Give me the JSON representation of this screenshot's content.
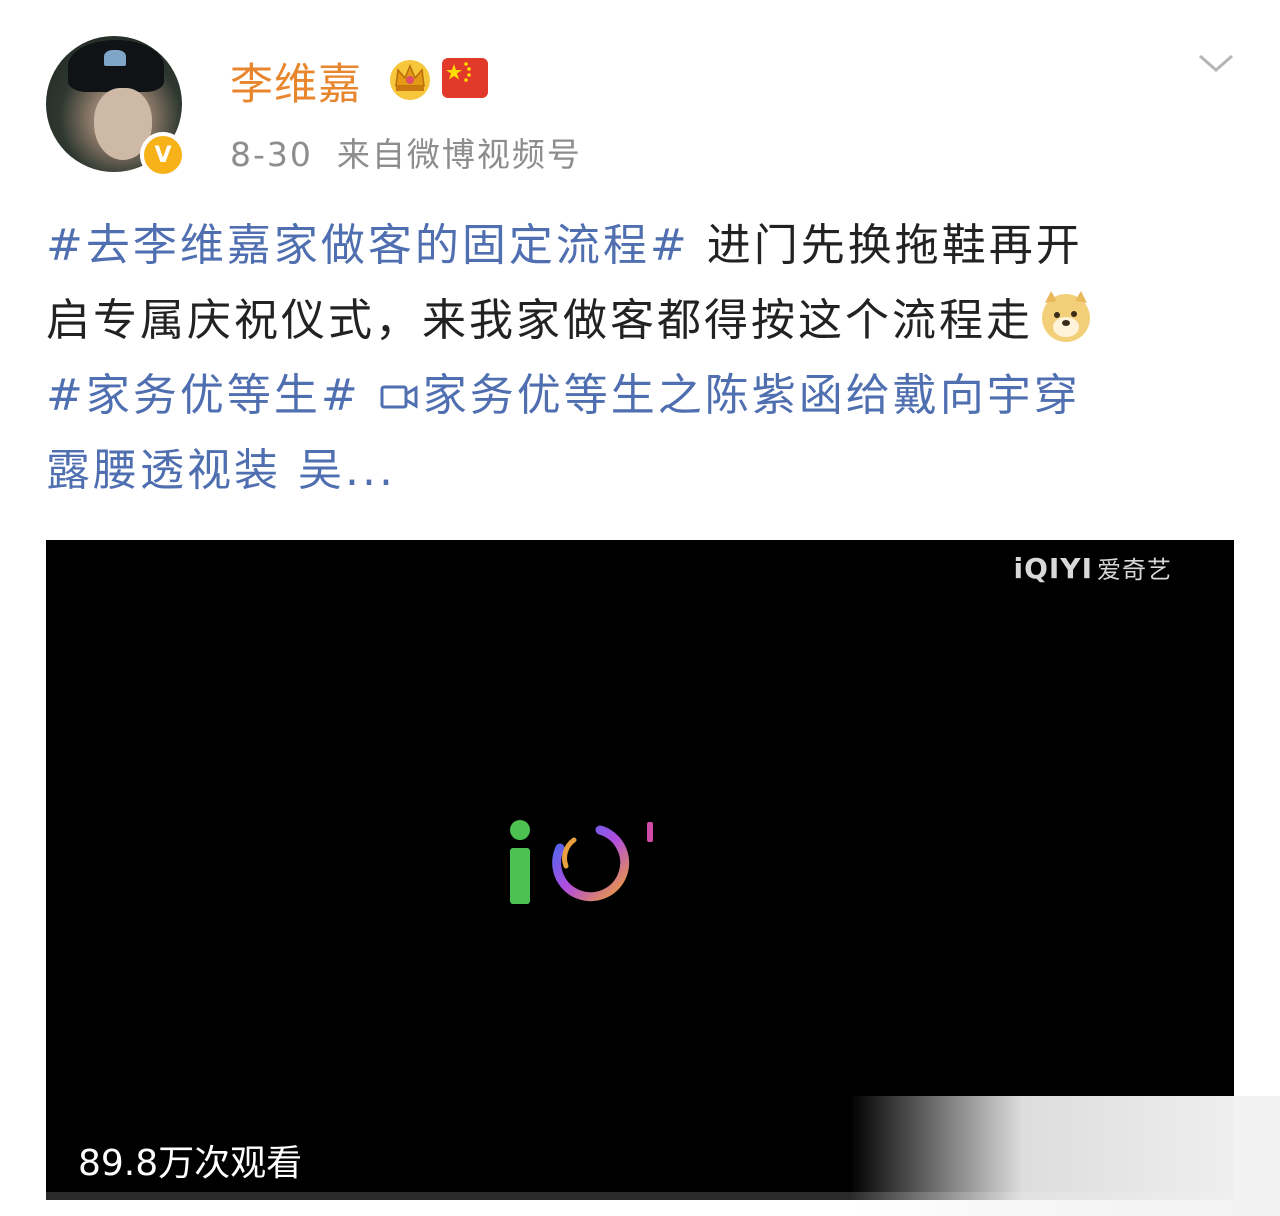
{
  "user": {
    "name": "李维嘉",
    "verified_mark": "V",
    "avatar_icon": "profile-photo",
    "badges": [
      "crown-icon",
      "china-flag-icon"
    ]
  },
  "meta": {
    "date": "8-30",
    "source": "来自微博视频号"
  },
  "menu_icon": "chevron-down-icon",
  "post": {
    "line1_tag": "#去李维嘉家做客的固定流程#",
    "line1_text": " 进门先换拖鞋再开",
    "line2_text": "启专属庆祝仪式，来我家做客都得按这个流程走",
    "line2_emoji": "doge-emoji-icon",
    "line3_tag": "#家务优等生#",
    "line3_video_link": "家务优等生之陈紫函给戴向宇穿",
    "line4_video_link": "露腰透视装 吴...",
    "video_link_icon": "video-link-icon"
  },
  "video": {
    "watermark_latin": "iQIYI",
    "watermark_cn": "爱奇艺",
    "view_count": "89.8万次观看",
    "loading_icon": "iqiyi-loading-icon"
  },
  "colors": {
    "username": "#e8862d",
    "tag": "#4f6fb0",
    "meta": "#8d8d8d",
    "text": "#222222",
    "video_bg": "#000000"
  }
}
